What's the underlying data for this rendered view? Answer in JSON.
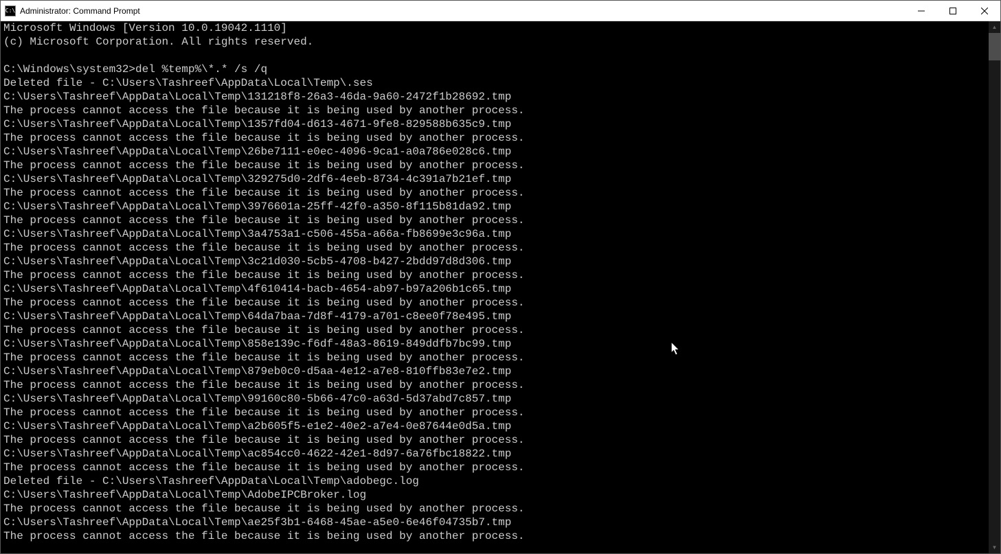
{
  "window": {
    "title": "Administrator: Command Prompt"
  },
  "terminal": {
    "header1": "Microsoft Windows [Version 10.0.19042.1110]",
    "header2": "(c) Microsoft Corporation. All rights reserved.",
    "prompt": "C:\\Windows\\system32>",
    "command": "del %temp%\\*.* /s /q",
    "lines": [
      "Deleted file - C:\\Users\\Tashreef\\AppData\\Local\\Temp\\.ses",
      "C:\\Users\\Tashreef\\AppData\\Local\\Temp\\131218f8-26a3-46da-9a60-2472f1b28692.tmp",
      "The process cannot access the file because it is being used by another process.",
      "C:\\Users\\Tashreef\\AppData\\Local\\Temp\\1357fd04-d613-4671-9fe8-829588b635c9.tmp",
      "The process cannot access the file because it is being used by another process.",
      "C:\\Users\\Tashreef\\AppData\\Local\\Temp\\26be7111-e0ec-4096-9ca1-a0a786e028c6.tmp",
      "The process cannot access the file because it is being used by another process.",
      "C:\\Users\\Tashreef\\AppData\\Local\\Temp\\329275d0-2df6-4eeb-8734-4c391a7b21ef.tmp",
      "The process cannot access the file because it is being used by another process.",
      "C:\\Users\\Tashreef\\AppData\\Local\\Temp\\3976601a-25ff-42f0-a350-8f115b81da92.tmp",
      "The process cannot access the file because it is being used by another process.",
      "C:\\Users\\Tashreef\\AppData\\Local\\Temp\\3a4753a1-c506-455a-a66a-fb8699e3c96a.tmp",
      "The process cannot access the file because it is being used by another process.",
      "C:\\Users\\Tashreef\\AppData\\Local\\Temp\\3c21d030-5cb5-4708-b427-2bdd97d8d306.tmp",
      "The process cannot access the file because it is being used by another process.",
      "C:\\Users\\Tashreef\\AppData\\Local\\Temp\\4f610414-bacb-4654-ab97-b97a206b1c65.tmp",
      "The process cannot access the file because it is being used by another process.",
      "C:\\Users\\Tashreef\\AppData\\Local\\Temp\\64da7baa-7d8f-4179-a701-c8ee0f78e495.tmp",
      "The process cannot access the file because it is being used by another process.",
      "C:\\Users\\Tashreef\\AppData\\Local\\Temp\\858e139c-f6df-48a3-8619-849ddfb7bc99.tmp",
      "The process cannot access the file because it is being used by another process.",
      "C:\\Users\\Tashreef\\AppData\\Local\\Temp\\879eb0c0-d5aa-4e12-a7e8-810ffb83e7e2.tmp",
      "The process cannot access the file because it is being used by another process.",
      "C:\\Users\\Tashreef\\AppData\\Local\\Temp\\99160c80-5b66-47c0-a63d-5d37abd7c857.tmp",
      "The process cannot access the file because it is being used by another process.",
      "C:\\Users\\Tashreef\\AppData\\Local\\Temp\\a2b605f5-e1e2-40e2-a7e4-0e87644e0d5a.tmp",
      "The process cannot access the file because it is being used by another process.",
      "C:\\Users\\Tashreef\\AppData\\Local\\Temp\\ac854cc0-4622-42e1-8d97-6a76fbc18822.tmp",
      "The process cannot access the file because it is being used by another process.",
      "Deleted file - C:\\Users\\Tashreef\\AppData\\Local\\Temp\\adobegc.log",
      "C:\\Users\\Tashreef\\AppData\\Local\\Temp\\AdobeIPCBroker.log",
      "The process cannot access the file because it is being used by another process.",
      "C:\\Users\\Tashreef\\AppData\\Local\\Temp\\ae25f3b1-6468-45ae-a5e0-6e46f04735b7.tmp",
      "The process cannot access the file because it is being used by another process."
    ]
  }
}
